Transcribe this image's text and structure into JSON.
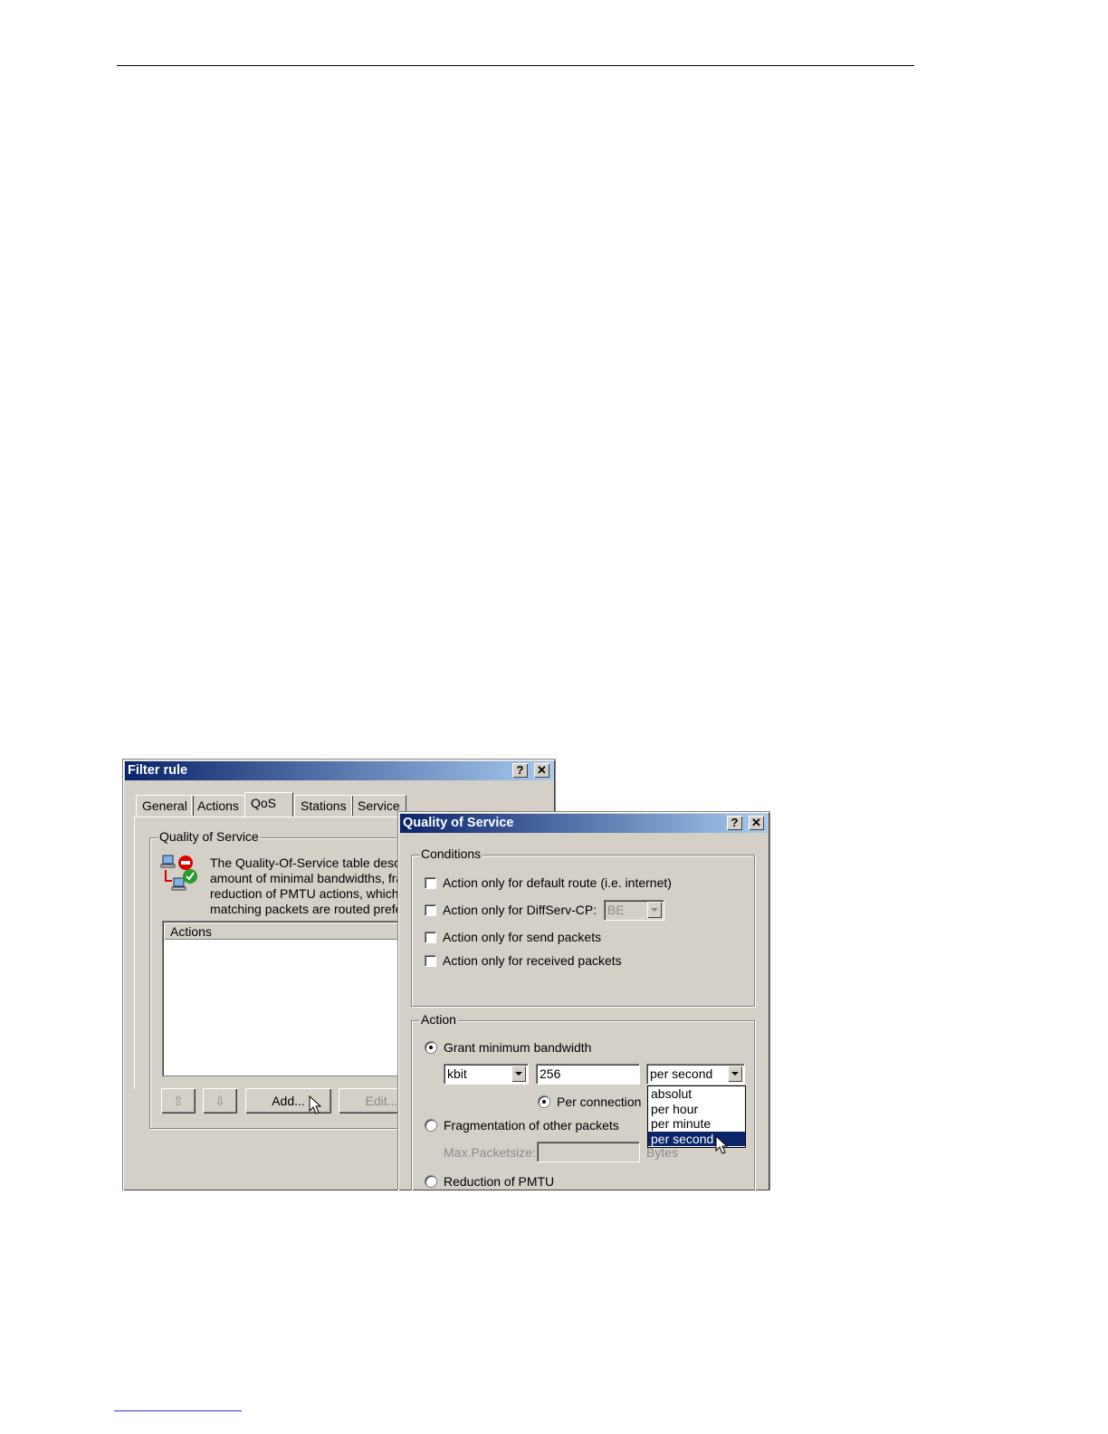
{
  "filter_rule": {
    "title": "Filter rule",
    "help_btn": "?",
    "close_btn": "✕",
    "tabs": [
      "General",
      "Actions",
      "QoS",
      "Stations",
      "Service"
    ],
    "active_tab": "QoS",
    "group_title": "Quality of Service",
    "description_lines": [
      "The Quality-Of-Service table descr",
      "amount of minimal bandwidths, frag",
      "reduction of PMTU actions, which",
      "matching packets are routed prefe"
    ],
    "list_header": "Actions",
    "up_btn": "⇧",
    "down_btn": "⇩",
    "add_btn": "Add...",
    "edit_btn": "Edit..."
  },
  "qos_dialog": {
    "title": "Quality of Service",
    "help_btn": "?",
    "close_btn": "✕",
    "conditions_title": "Conditions",
    "conditions": [
      {
        "label": "Action only for default route (i.e. internet)",
        "checked": false
      },
      {
        "label": "Action only for DiffServ-CP:",
        "checked": false
      },
      {
        "label": "Action only for send packets",
        "checked": false
      },
      {
        "label": "Action only for received packets",
        "checked": false
      }
    ],
    "diffserv_value": "BE",
    "action_title": "Action",
    "grant_label": "Grant minimum bandwidth",
    "unit_value": "kbit",
    "bandwidth_value": "256",
    "rate_value": "per second",
    "per_connection_label": "Per connection",
    "fragmentation_label": "Fragmentation of other packets",
    "max_packetsize_label": "Max.Packetsize:",
    "bytes_label": "Bytes",
    "reduction_label": "Reduction of PMTU",
    "rate_options": [
      "absolut",
      "per hour",
      "per minute",
      "per second"
    ],
    "rate_selected": "per second"
  }
}
